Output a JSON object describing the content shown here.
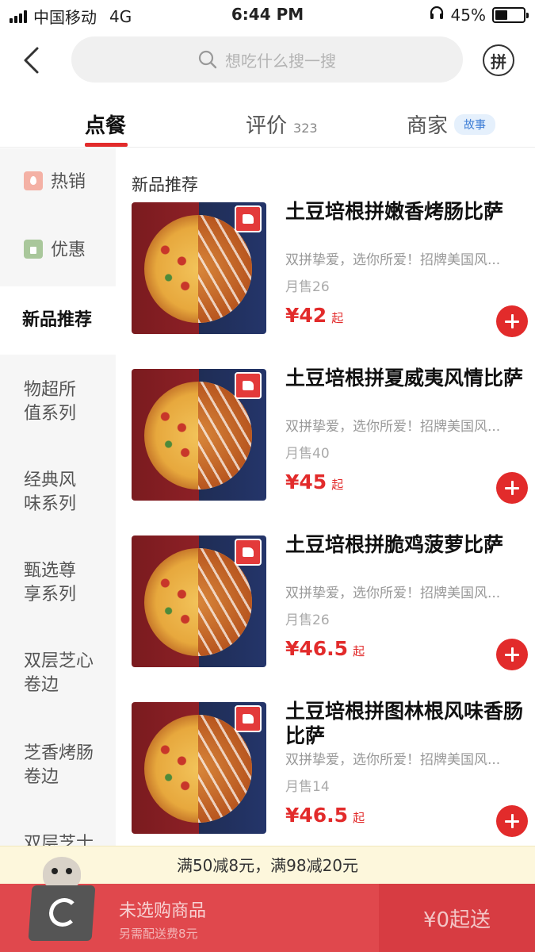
{
  "status_bar": {
    "carrier": "中国移动",
    "network": "4G",
    "time": "6:44 PM",
    "battery_percent": "45%",
    "battery_level": 0.45
  },
  "header": {
    "search_placeholder": "想吃什么搜一搜",
    "pin_label": "拼"
  },
  "tabs": [
    {
      "label": "点餐",
      "active": true
    },
    {
      "label": "评价",
      "count": "323"
    },
    {
      "label": "商家",
      "badge": "故事"
    }
  ],
  "sidebar": {
    "items": [
      {
        "label": "热销",
        "icon": "fire-icon"
      },
      {
        "label": "优惠",
        "icon": "discount-icon"
      },
      {
        "label": "新品推荐",
        "active": true
      },
      {
        "label": "物超所值系列"
      },
      {
        "label": "经典风味系列"
      },
      {
        "label": "甄选尊享系列"
      },
      {
        "label": "双层芝心卷边"
      },
      {
        "label": "芝香烤肠卷边"
      },
      {
        "label": "双层芝士"
      }
    ]
  },
  "main": {
    "section_title": "新品推荐",
    "products": [
      {
        "name": "土豆培根拼嫩香烤肠比萨",
        "desc": "双拼挚爱，选你所爱！招牌美国风...",
        "sales": "月售26",
        "price": "¥42",
        "price_suffix": "起"
      },
      {
        "name": "土豆培根拼夏威夷风情比萨",
        "desc": "双拼挚爱，选你所爱！招牌美国风...",
        "sales": "月售40",
        "price": "¥45",
        "price_suffix": "起"
      },
      {
        "name": "土豆培根拼脆鸡菠萝比萨",
        "desc": "双拼挚爱，选你所爱！招牌美国风...",
        "sales": "月售26",
        "price": "¥46.5",
        "price_suffix": "起"
      },
      {
        "name": "土豆培根拼图林根风味香肠比萨",
        "desc": "双拼挚爱，选你所爱！招牌美国风...",
        "sales": "月售14",
        "price": "¥46.5",
        "price_suffix": "起"
      }
    ]
  },
  "promo": {
    "text": "满50减8元，满98减20元"
  },
  "cart": {
    "title": "未选购商品",
    "subtitle": "另需配送费8元",
    "min_order": "¥0起送"
  },
  "colors": {
    "accent": "#e22b2b",
    "bottom_bar": "#e0484d",
    "promo_bg": "#fdf7dc"
  }
}
